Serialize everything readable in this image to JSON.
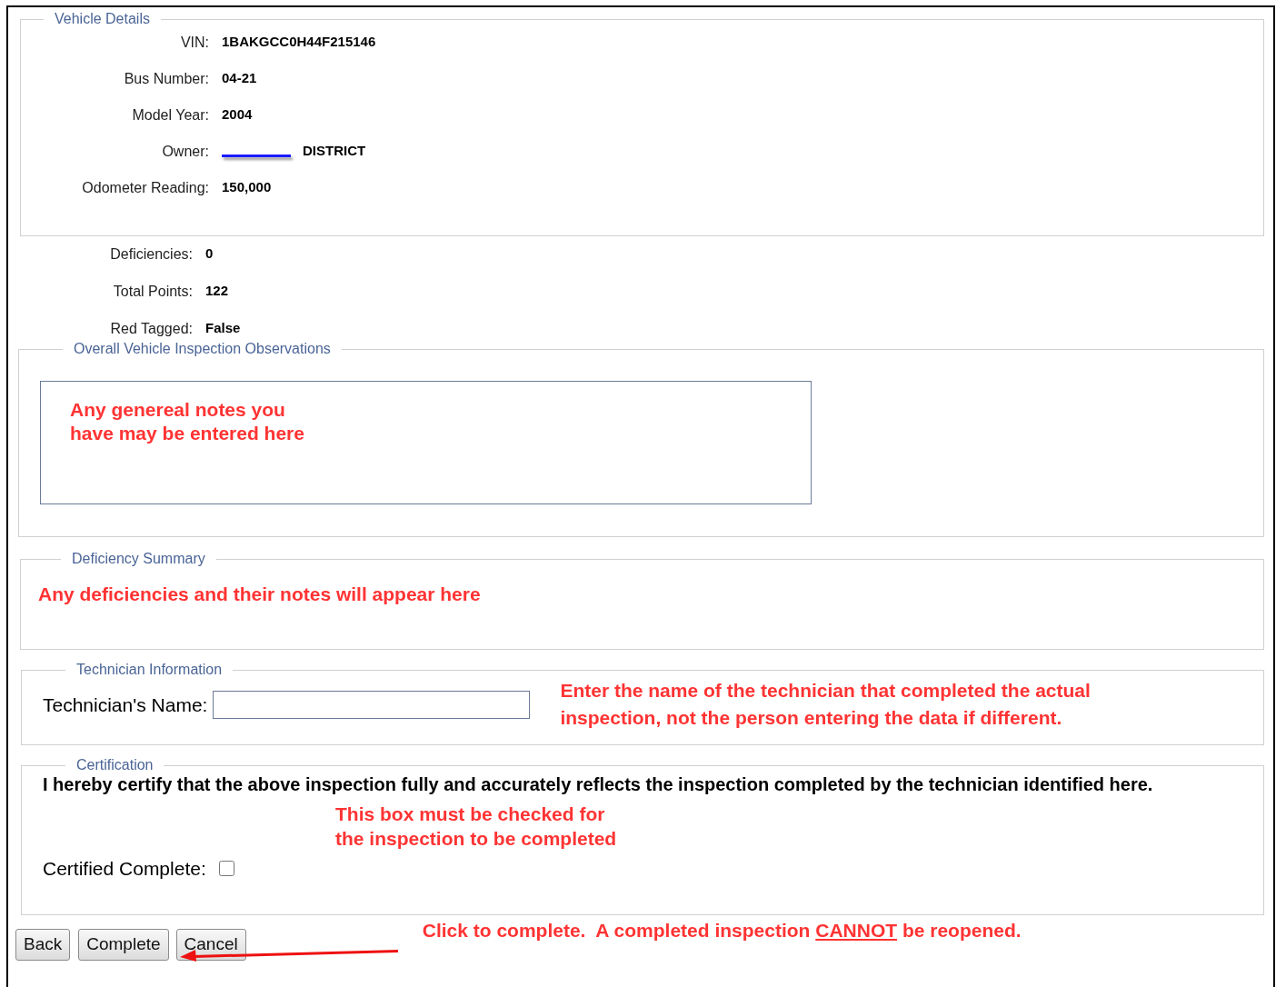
{
  "vehicle_details": {
    "legend": "Vehicle Details",
    "fields": [
      {
        "label": "VIN:",
        "value": "1BAKGCC0H44F215146",
        "redacted": false
      },
      {
        "label": "Bus Number:",
        "value": "04-21",
        "redacted": false
      },
      {
        "label": "Model Year:",
        "value": "2004",
        "redacted": false
      },
      {
        "label": "Owner:",
        "value": "DISTRICT",
        "redacted": true
      },
      {
        "label": "Odometer Reading:",
        "value": "150,000",
        "redacted": false
      }
    ]
  },
  "summary": [
    {
      "label": "Deficiencies:",
      "value": "0"
    },
    {
      "label": "Total Points:",
      "value": "122"
    },
    {
      "label": "Red Tagged:",
      "value": "False"
    }
  ],
  "observations": {
    "legend": "Overall Vehicle Inspection Observations",
    "notes": "Any genereal notes you\nhave may be entered here"
  },
  "deficiency_summary": {
    "legend": "Deficiency Summary",
    "note": "Any deficiencies and their notes will appear here"
  },
  "technician": {
    "legend": "Technician Information",
    "label": "Technician's Name:",
    "note": "Enter the name of the technician that completed the actual inspection, not the person entering the data if different."
  },
  "certification": {
    "legend": "Certification",
    "statement": "I hereby certify that the above inspection fully and accurately reflects the inspection completed by the technician identified here.",
    "note": "This box must be checked for the inspection to be completed",
    "checkbox_label": "Certified Complete:",
    "checked": false
  },
  "buttons": [
    "Back",
    "Complete",
    "Cancel"
  ],
  "footer_note": {
    "before": "Click to complete.  A completed inspection ",
    "underlined": "CANNOT",
    "after": " be reopened."
  }
}
